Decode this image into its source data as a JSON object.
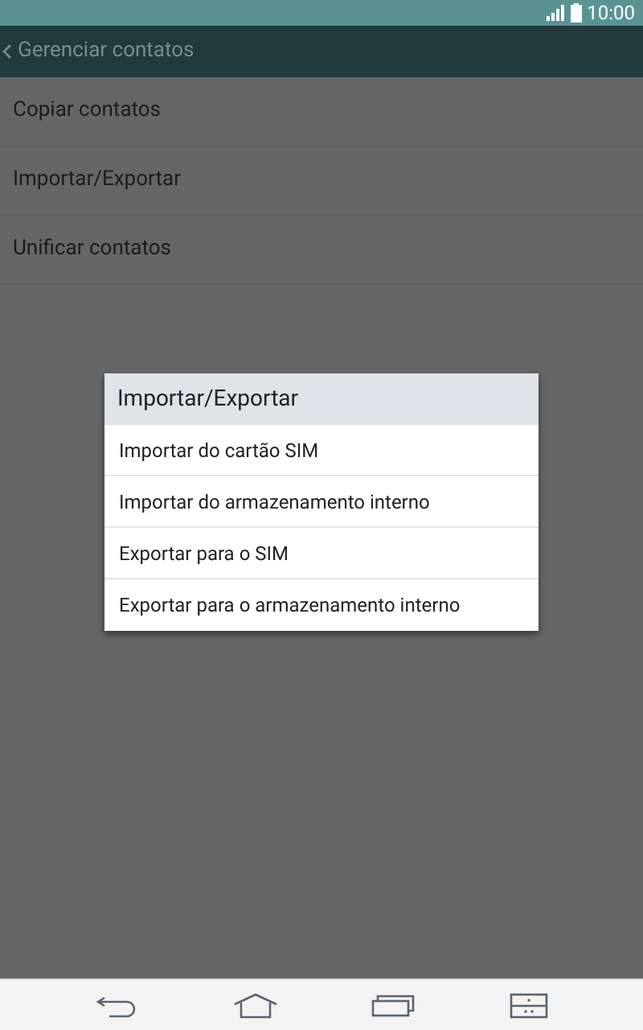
{
  "status_bar": {
    "time": "10:00"
  },
  "header": {
    "title": "Gerenciar contatos"
  },
  "list": {
    "items": [
      {
        "label": "Copiar contatos"
      },
      {
        "label": "Importar/Exportar"
      },
      {
        "label": "Unificar contatos"
      }
    ]
  },
  "dialog": {
    "title": "Importar/Exportar",
    "options": [
      {
        "label": "Importar do cartão SIM"
      },
      {
        "label": "Importar do armazenamento interno"
      },
      {
        "label": "Exportar para o SIM"
      },
      {
        "label": "Exportar para o armazenamento interno"
      }
    ]
  }
}
